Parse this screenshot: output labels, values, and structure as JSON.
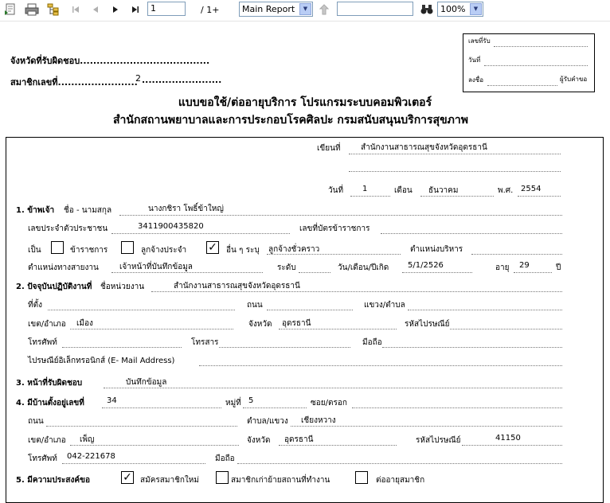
{
  "toolbar": {
    "page_number": "1",
    "page_total": "/ 1+",
    "report_select": "Main Report",
    "search_value": "",
    "zoom": "100%"
  },
  "receipt_box": {
    "received_no": "เลขที่รับ",
    "date": "วันที่",
    "signature": "ลงชื่อ",
    "receiver": "ผู้รับคำขอ"
  },
  "header": {
    "province_label": "จังหวัดที่รับผิดชอบ.......................................",
    "member_label": "สมาชิกเลขที่........................",
    "member_no": "2",
    "member_dots": "........................",
    "title1": "แบบขอใช้/ต่ออายุบริการ  โปรแกรมระบบคอมพิวเตอร์",
    "title2": "สำนักสถานพยาบาลและการประกอบโรคศิลปะ   กรมสนับสนุนบริการสุขภาพ"
  },
  "form": {
    "written_at_label": "เขียนที่",
    "written_at": "สำนักงานสาธารณสุขจังหวัดอุดรธานี",
    "day_label": "วันที่",
    "day": "1",
    "month_label": "เดือน",
    "month": "ธันวาคม",
    "year_label": "พ.ศ.",
    "year": "2554",
    "s1_label": "1. ข้าพเจ้า",
    "name_label": "ชื่อ - นามสกุล",
    "name": "นางกชิรา  โพธิ์ข้าใหญ่",
    "idcard_label": "เลขประจำตัวประชาชน",
    "idcard": "3411900435820",
    "govcard_label": "เลขที่บัตรข้าราชการ",
    "is_label": "เป็น",
    "opt_gov": "ข้าราชการ",
    "opt_perm": "ลูกจ้างประจำ",
    "opt_other": "อื่น ๆ ระบุ",
    "other_value": "ลูกจ้างชั่วคราว",
    "admin_pos_label": "ตำแหน่งบริหาร",
    "line_pos_label": "ตำแหน่งทางสายงาน",
    "line_pos": "เจ้าหน้าที่บันทึกข้อมูล",
    "level_label": "ระดับ",
    "dob_label": "วัน/เดือน/ปีเกิด",
    "dob": "5/1/2526",
    "age_label": "อายุ",
    "age": "29",
    "age_unit": "ปี",
    "s2_label": "2. ปัจจุบันปฏิบัติงานที่",
    "unit_label": "ชื่อหน่วยงาน",
    "unit": "สำนักงานสาธารณสุขจังหวัดอุดรธานี",
    "addr_label": "ที่ตั้ง",
    "road_label": "ถนน",
    "subdistrict_label": "แขวง/ตำบล",
    "district_label": "เขต/อำเภอ",
    "district": "เมือง",
    "province_label": "จังหวัด",
    "province": "อุดรธานี",
    "zip_label": "รหัสไปรษณีย์",
    "phone_label": "โทรศัพท์",
    "fax_label": "โทรสาร",
    "mobile_label": "มือถือ",
    "email_label": "ไปรษณีย์อิเล็กทรอนิกส์ (E- Mail Address)",
    "s3_label": "3. หน้าที่รับผิดชอบ",
    "duty": "บันทึกข้อมูล",
    "s4_label": "4. มีบ้านตั้งอยู่เลขที่",
    "house_no": "34",
    "moo_label": "หมู่ที่",
    "moo": "5",
    "soi_label": "ซอย/ตรอก",
    "road2_label": "ถนน",
    "subdistrict2_label": "ตำบล/แขวง",
    "subdistrict2": "เชียงหวาง",
    "district2_label": "เขต/อำเภอ",
    "district2": "เพ็ญ",
    "province2_label": "จังหวัด",
    "province2": "อุดรธานี",
    "zip2_label": "รหัสไปรษณีย์",
    "zip2": "41150",
    "phone2_label": "โทรศัพท์",
    "phone2": "042-221678",
    "mobile2_label": "มือถือ",
    "s5_label": "5. มีความประสงค์ขอ",
    "opt_apply": "สมัครสมาชิกใหม่",
    "opt_move": "สมาชิกเก่าย้ายสถานที่ทำงาน",
    "opt_renew": "ต่ออายุสมาชิก",
    "check_mark": "✓"
  }
}
